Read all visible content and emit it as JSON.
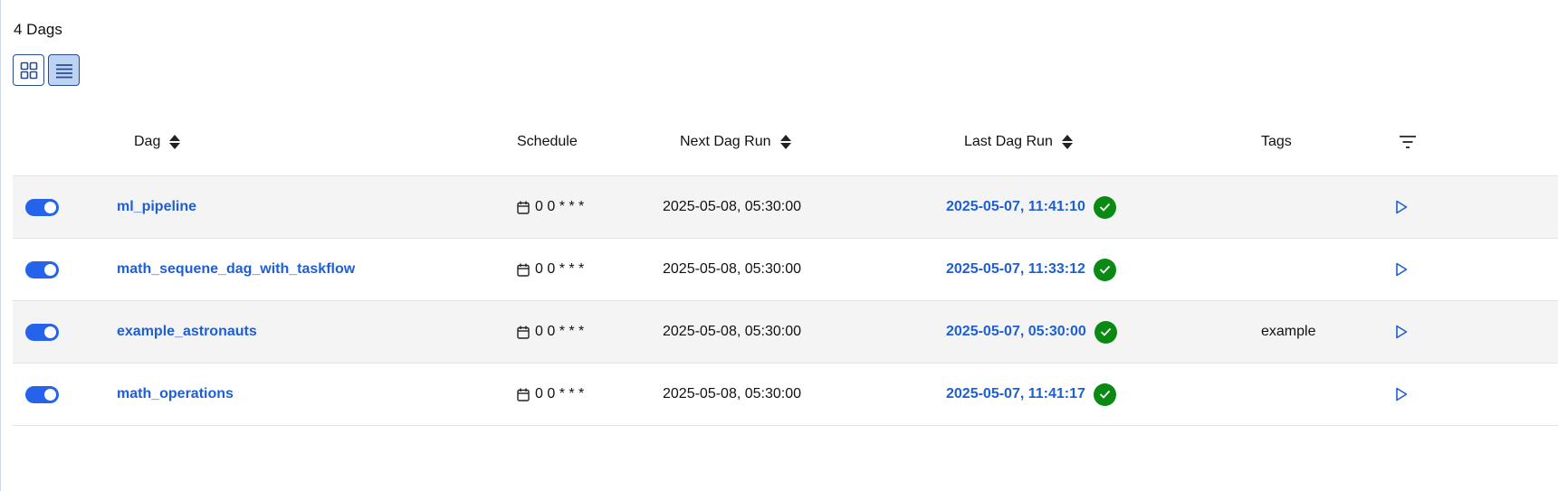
{
  "summary": {
    "dag_count_label": "4 Dags"
  },
  "view_toggle": {
    "active": "list"
  },
  "columns": {
    "dag": "Dag",
    "schedule": "Schedule",
    "next_dag_run": "Next Dag Run",
    "last_dag_run": "Last Dag Run",
    "tags": "Tags"
  },
  "dags": [
    {
      "enabled": true,
      "name": "ml_pipeline",
      "schedule": "0 0 * * *",
      "next_run": "2025-05-08, 05:30:00",
      "last_run": "2025-05-07, 11:41:10",
      "last_run_status": "success",
      "tags": ""
    },
    {
      "enabled": true,
      "name": "math_sequene_dag_with_taskflow",
      "schedule": "0 0 * * *",
      "next_run": "2025-05-08, 05:30:00",
      "last_run": "2025-05-07, 11:33:12",
      "last_run_status": "success",
      "tags": ""
    },
    {
      "enabled": true,
      "name": "example_astronauts",
      "schedule": "0 0 * * *",
      "next_run": "2025-05-08, 05:30:00",
      "last_run": "2025-05-07, 05:30:00",
      "last_run_status": "success",
      "tags": "example"
    },
    {
      "enabled": true,
      "name": "math_operations",
      "schedule": "0 0 * * *",
      "next_run": "2025-05-08, 05:30:00",
      "last_run": "2025-05-07, 11:41:17",
      "last_run_status": "success",
      "tags": ""
    }
  ],
  "colors": {
    "accent": "#2563eb",
    "link": "#1d5fd6",
    "success": "#0a8a12",
    "row_shade": "#f4f4f4"
  }
}
